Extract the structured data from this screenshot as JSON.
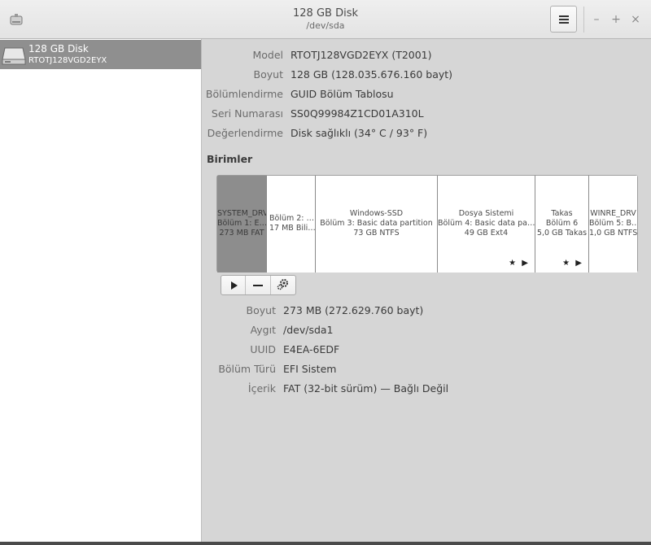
{
  "window": {
    "title": "128 GB Disk",
    "subtitle": "/dev/sda",
    "menu_icon": "hamburger-menu-icon",
    "minimize_label": "–",
    "maximize_label": "+",
    "close_label": "×"
  },
  "sidebar": {
    "items": [
      {
        "name": "128 GB Disk",
        "serial": "RTOTJ128VGD2EYX",
        "icon": "hard-drive-icon",
        "selected": true
      }
    ]
  },
  "disk": {
    "rows": [
      {
        "label": "Model",
        "value": "RTOTJ128VGD2EYX (T2001)"
      },
      {
        "label": "Boyut",
        "value": "128 GB (128.035.676.160 bayt)"
      },
      {
        "label": "Bölümlendirme",
        "value": "GUID Bölüm Tablosu"
      },
      {
        "label": "Seri Numarası",
        "value": "SS0Q99984Z1CD01A310L"
      },
      {
        "label": "Değerlendirme",
        "value": "Disk sağlıklı (34° C / 93° F)"
      }
    ]
  },
  "volumes": {
    "heading": "Birimler",
    "partitions": [
      {
        "line1": "SYSTEM_DRV",
        "line2": "Bölüm 1: E…",
        "line3": "273 MB FAT",
        "selected": true,
        "marks": ""
      },
      {
        "line1": "",
        "line2": "Bölüm 2: …",
        "line3": "17 MB Bili…",
        "selected": false,
        "marks": ""
      },
      {
        "line1": "Windows-SSD",
        "line2": "Bölüm 3: Basic data partition",
        "line3": "73 GB NTFS",
        "selected": false,
        "marks": ""
      },
      {
        "line1": "Dosya Sistemi",
        "line2": "Bölüm 4: Basic data pa…",
        "line3": "49 GB Ext4",
        "selected": false,
        "marks": "★ ▶"
      },
      {
        "line1": "Takas",
        "line2": "Bölüm 6",
        "line3": "5,0 GB Takas",
        "selected": false,
        "marks": "★ ▶"
      },
      {
        "line1": "WINRE_DRV",
        "line2": "Bölüm 5: B…",
        "line3": "1,0 GB NTFS",
        "selected": false,
        "marks": ""
      }
    ],
    "tools": [
      {
        "icon": "play-icon"
      },
      {
        "icon": "minus-icon"
      },
      {
        "icon": "gears-icon"
      }
    ]
  },
  "partition_details": {
    "rows": [
      {
        "label": "Boyut",
        "value": "273 MB (272.629.760 bayt)"
      },
      {
        "label": "Aygıt",
        "value": "/dev/sda1"
      },
      {
        "label": "UUID",
        "value": "E4EA-6EDF"
      },
      {
        "label": "Bölüm Türü",
        "value": "EFI Sistem"
      },
      {
        "label": "İçerik",
        "value": "FAT (32-bit sürüm) — Bağlı Değil"
      }
    ]
  }
}
